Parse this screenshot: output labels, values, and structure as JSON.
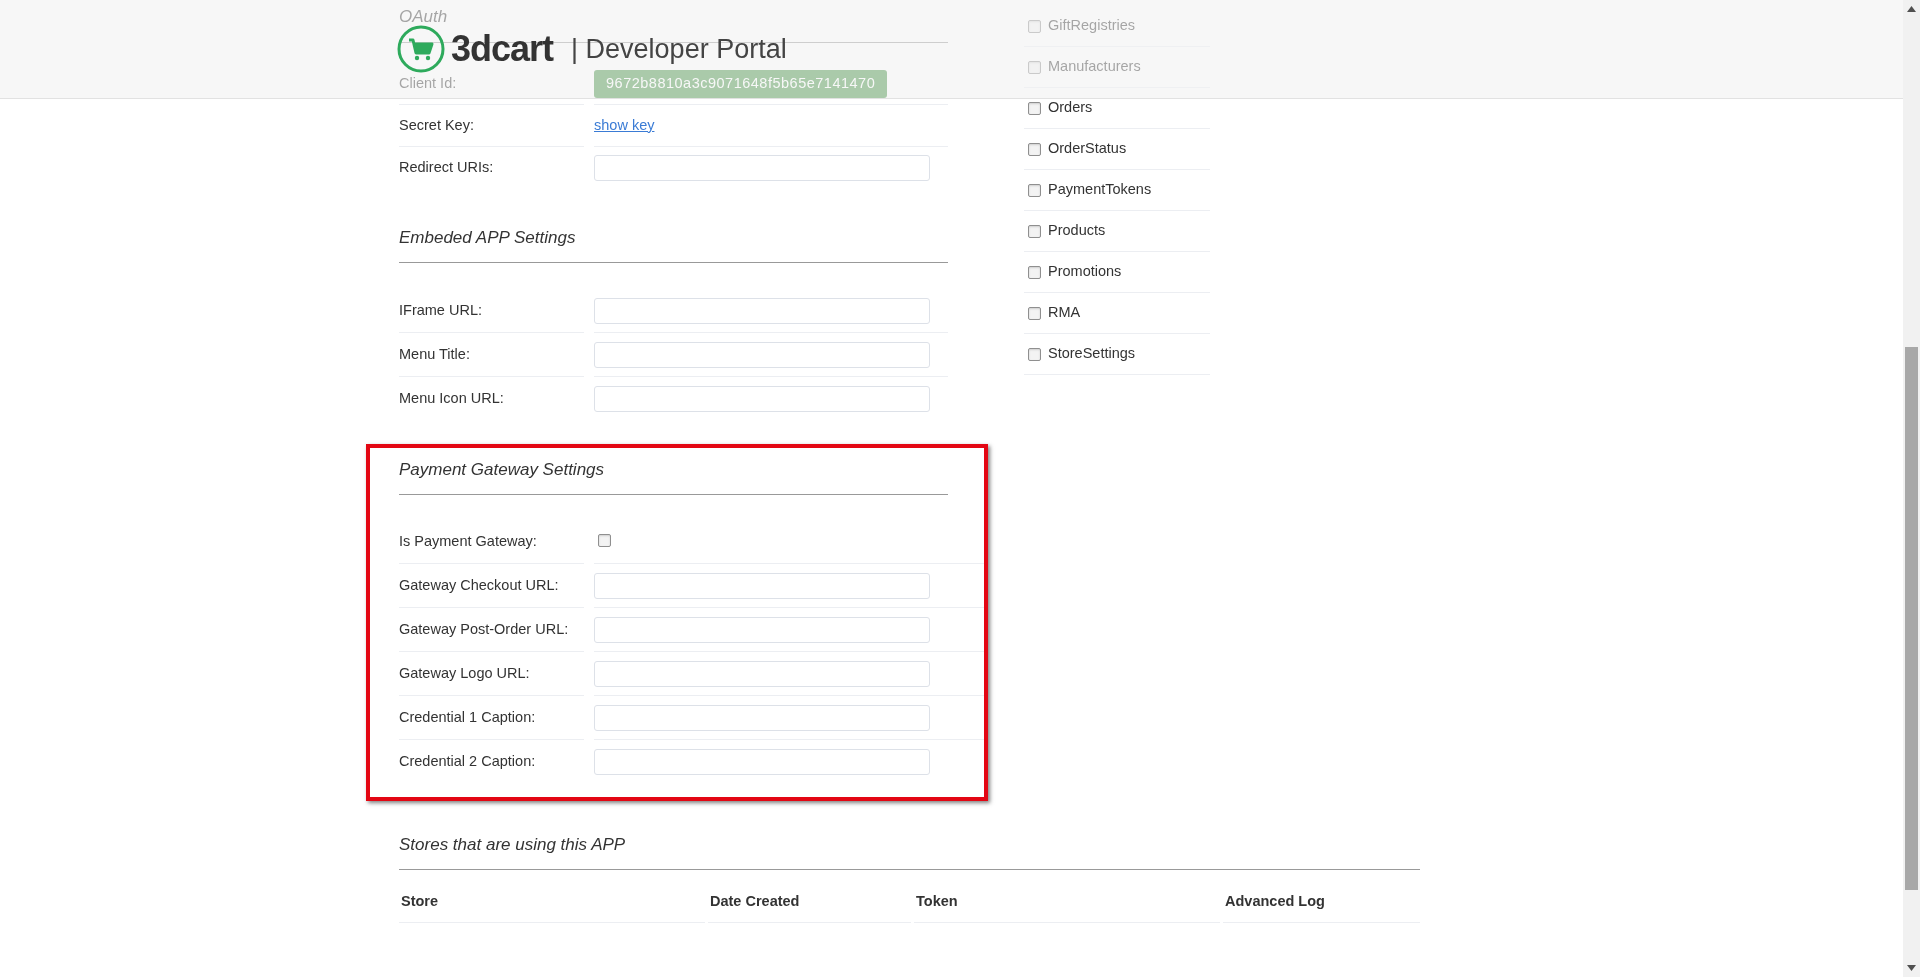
{
  "header": {
    "logo_text": "3dcart",
    "title": "| Developer Portal"
  },
  "oauth": {
    "heading": "OAuth",
    "rows": [
      {
        "label": "Client Id:",
        "kind": "value",
        "value": "9672b8810a3c9071648f5b65e7141470"
      },
      {
        "label": "Secret Key:",
        "kind": "link",
        "value": "show key"
      },
      {
        "label": "Redirect URIs:",
        "kind": "field"
      }
    ]
  },
  "embedded_app_settings": {
    "heading": "Embeded APP Settings",
    "rows": [
      {
        "label": "IFrame URL:",
        "kind": "field"
      },
      {
        "label": "Menu Title:",
        "kind": "field"
      },
      {
        "label": "Menu Icon URL:",
        "kind": "field"
      }
    ]
  },
  "payment_gateway_settings": {
    "heading": "Payment Gateway Settings",
    "highlighted": true,
    "rows": [
      {
        "label": "Is Payment Gateway:",
        "kind": "checkbox",
        "checked": false
      },
      {
        "label": "Gateway Checkout URL:",
        "kind": "field"
      },
      {
        "label": "Gateway Post-Order URL:",
        "kind": "field"
      },
      {
        "label": "Gateway Logo URL:",
        "kind": "field"
      },
      {
        "label": "Credential 1 Caption:",
        "kind": "field"
      },
      {
        "label": "Credential 2 Caption:",
        "kind": "field"
      }
    ]
  },
  "permissions": [
    {
      "label": "GiftRegistries",
      "checked": false
    },
    {
      "label": "Manufacturers",
      "checked": false
    },
    {
      "label": "Orders",
      "checked": false
    },
    {
      "label": "OrderStatus",
      "checked": false
    },
    {
      "label": "PaymentTokens",
      "checked": false
    },
    {
      "label": "Products",
      "checked": false
    },
    {
      "label": "Promotions",
      "checked": false
    },
    {
      "label": "RMA",
      "checked": false
    },
    {
      "label": "StoreSettings",
      "checked": false
    }
  ],
  "stores": {
    "heading": "Stores that are using this APP",
    "table": {
      "columns": [
        "Store",
        "Date Created",
        "Token",
        "Advanced Log"
      ]
    }
  }
}
